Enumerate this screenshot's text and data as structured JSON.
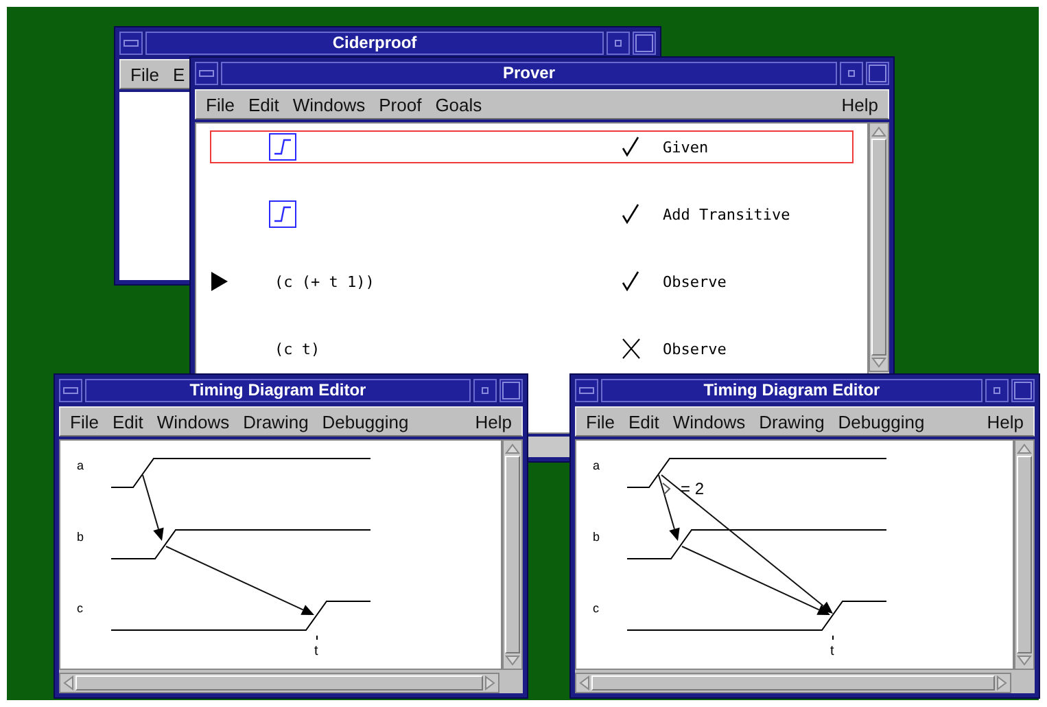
{
  "windows": [
    {
      "kind": "plain",
      "title": "Ciderproof",
      "menu": [
        {
          "label": "File",
          "right": false
        },
        {
          "label": "E",
          "right": false
        }
      ]
    },
    {
      "kind": "prover",
      "title": "Prover",
      "menu": [
        {
          "label": "File",
          "right": false
        },
        {
          "label": "Edit",
          "right": false
        },
        {
          "label": "Windows",
          "right": false
        },
        {
          "label": "Proof",
          "right": false
        },
        {
          "label": "Goals",
          "right": false
        },
        {
          "label": "Help",
          "right": true
        }
      ],
      "rows": [
        {
          "kind": "waveform",
          "selected": true,
          "current": false,
          "proved": true,
          "label": "Given"
        },
        {
          "kind": "waveform",
          "selected": false,
          "current": false,
          "proved": true,
          "label": "Add Transitive"
        },
        {
          "kind": "expression",
          "expression": "(c (+ t 1))",
          "selected": false,
          "current": true,
          "proved": true,
          "label": "Observe"
        },
        {
          "kind": "expression",
          "expression": "(c t)",
          "selected": false,
          "current": false,
          "proved": false,
          "label": "Observe"
        }
      ]
    },
    {
      "kind": "timing",
      "title": "Timing Diagram Editor",
      "menu": [
        {
          "label": "File",
          "right": false
        },
        {
          "label": "Edit",
          "right": false
        },
        {
          "label": "Windows",
          "right": false
        },
        {
          "label": "Drawing",
          "right": false
        },
        {
          "label": "Debugging",
          "right": false
        },
        {
          "label": "Help",
          "right": true
        }
      ],
      "signals": [
        "a",
        "b",
        "c"
      ],
      "time_label": "t",
      "arrows": [
        {
          "kind": "a_to_b"
        },
        {
          "kind": "b_to_c"
        }
      ]
    },
    {
      "kind": "timing",
      "title": "Timing Diagram Editor",
      "menu": [
        {
          "label": "File",
          "right": false
        },
        {
          "label": "Edit",
          "right": false
        },
        {
          "label": "Windows",
          "right": false
        },
        {
          "label": "Drawing",
          "right": false
        },
        {
          "label": "Debugging",
          "right": false
        },
        {
          "label": "Help",
          "right": true
        }
      ],
      "signals": [
        "a",
        "b",
        "c"
      ],
      "time_label": "t",
      "constraint": "= 2",
      "arrows": [
        {
          "kind": "a_to_b"
        },
        {
          "kind": "b_to_c"
        },
        {
          "kind": "a_to_c"
        }
      ]
    }
  ]
}
